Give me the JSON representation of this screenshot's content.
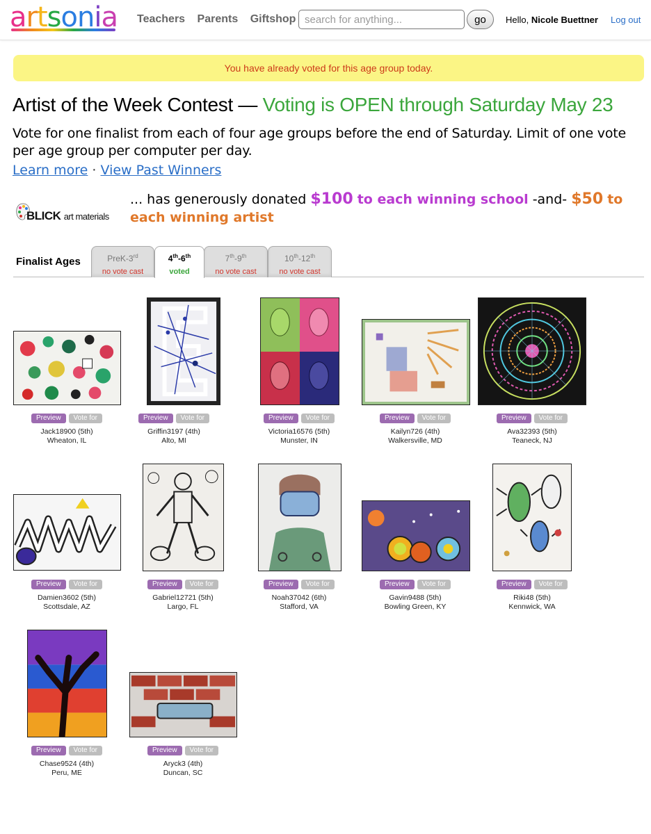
{
  "header": {
    "logo": "artsonia",
    "nav": [
      "Teachers",
      "Parents",
      "Giftshop"
    ],
    "search_placeholder": "search for anything...",
    "go_label": "go",
    "hello_prefix": "Hello,",
    "user_name": "Nicole Buettner",
    "logout_label": "Log out"
  },
  "alert": "You have already voted for this age group today.",
  "contest": {
    "title": "Artist of the Week Contest",
    "separator": "—",
    "status": "Voting is OPEN through Saturday May 23",
    "intro": "Vote for one finalist from each of four age groups before the end of Saturday. Limit of one vote per age group per computer per day.",
    "learn_more": "Learn more",
    "dot": "·",
    "past_winners": "View Past Winners"
  },
  "sponsor": {
    "brand": "BLICK",
    "brand_sub": "art materials",
    "text1": "... has generously donated",
    "amount1": "$100",
    "text2": "to each winning school",
    "and": "-and-",
    "amount2": "$50",
    "text3": "to each winning artist"
  },
  "tabs": {
    "label": "Finalist Ages",
    "items": [
      {
        "a": "PreK-3",
        "a_sup": "rd",
        "b": "",
        "b_sup": "",
        "status": "no vote cast",
        "active": false
      },
      {
        "a": "4",
        "a_sup": "th",
        "b": "-6",
        "b_sup": "th",
        "status": "voted",
        "active": true
      },
      {
        "a": "7",
        "a_sup": "th",
        "b": "-9",
        "b_sup": "th",
        "status": "no vote cast",
        "active": false
      },
      {
        "a": "10",
        "a_sup": "th",
        "b": "-12",
        "b_sup": "th",
        "status": "no vote cast",
        "active": false
      }
    ]
  },
  "buttons": {
    "preview": "Preview",
    "vote": "Vote for"
  },
  "finalists": [
    {
      "name": "Jack18900 (5th)",
      "location": "Wheaton, IL",
      "art": "painted-dots"
    },
    {
      "name": "Griffin3197 (4th)",
      "location": "Alto, MI",
      "art": "splatter-letter"
    },
    {
      "name": "Victoria16576 (5th)",
      "location": "Munster, IN",
      "art": "pop-portraits"
    },
    {
      "name": "Kailyn726 (4th)",
      "location": "Walkersville, MD",
      "art": "crayon-drawing"
    },
    {
      "name": "Ava32393 (5th)",
      "location": "Teaneck, NJ",
      "art": "string-mandala"
    },
    {
      "name": "Damien3602 (5th)",
      "location": "Scottsdale, AZ",
      "art": "name-graffiti"
    },
    {
      "name": "Gabriel12721 (5th)",
      "location": "Largo, FL",
      "art": "doodle-figure"
    },
    {
      "name": "Noah37042 (6th)",
      "location": "Stafford, VA",
      "art": "masked-doctor"
    },
    {
      "name": "Gavin9488 (5th)",
      "location": "Bowling Green, KY",
      "art": "space-planets"
    },
    {
      "name": "Riki48 (5th)",
      "location": "Kennwick, WA",
      "art": "beetles"
    },
    {
      "name": "Chase9524 (4th)",
      "location": "Peru, ME",
      "art": "sunset-tree"
    },
    {
      "name": "Aryck3 (4th)",
      "location": "Duncan, SC",
      "art": "brick-graffiti"
    }
  ],
  "colors": {
    "open_green": "#3ba63c",
    "alert_bg": "#fbf585",
    "alert_text": "#cc3a1a",
    "link_blue": "#2a6ec7",
    "donation_purple": "#b93bd0",
    "donation_orange": "#e0782a",
    "preview_purple": "#9c6bb0"
  }
}
